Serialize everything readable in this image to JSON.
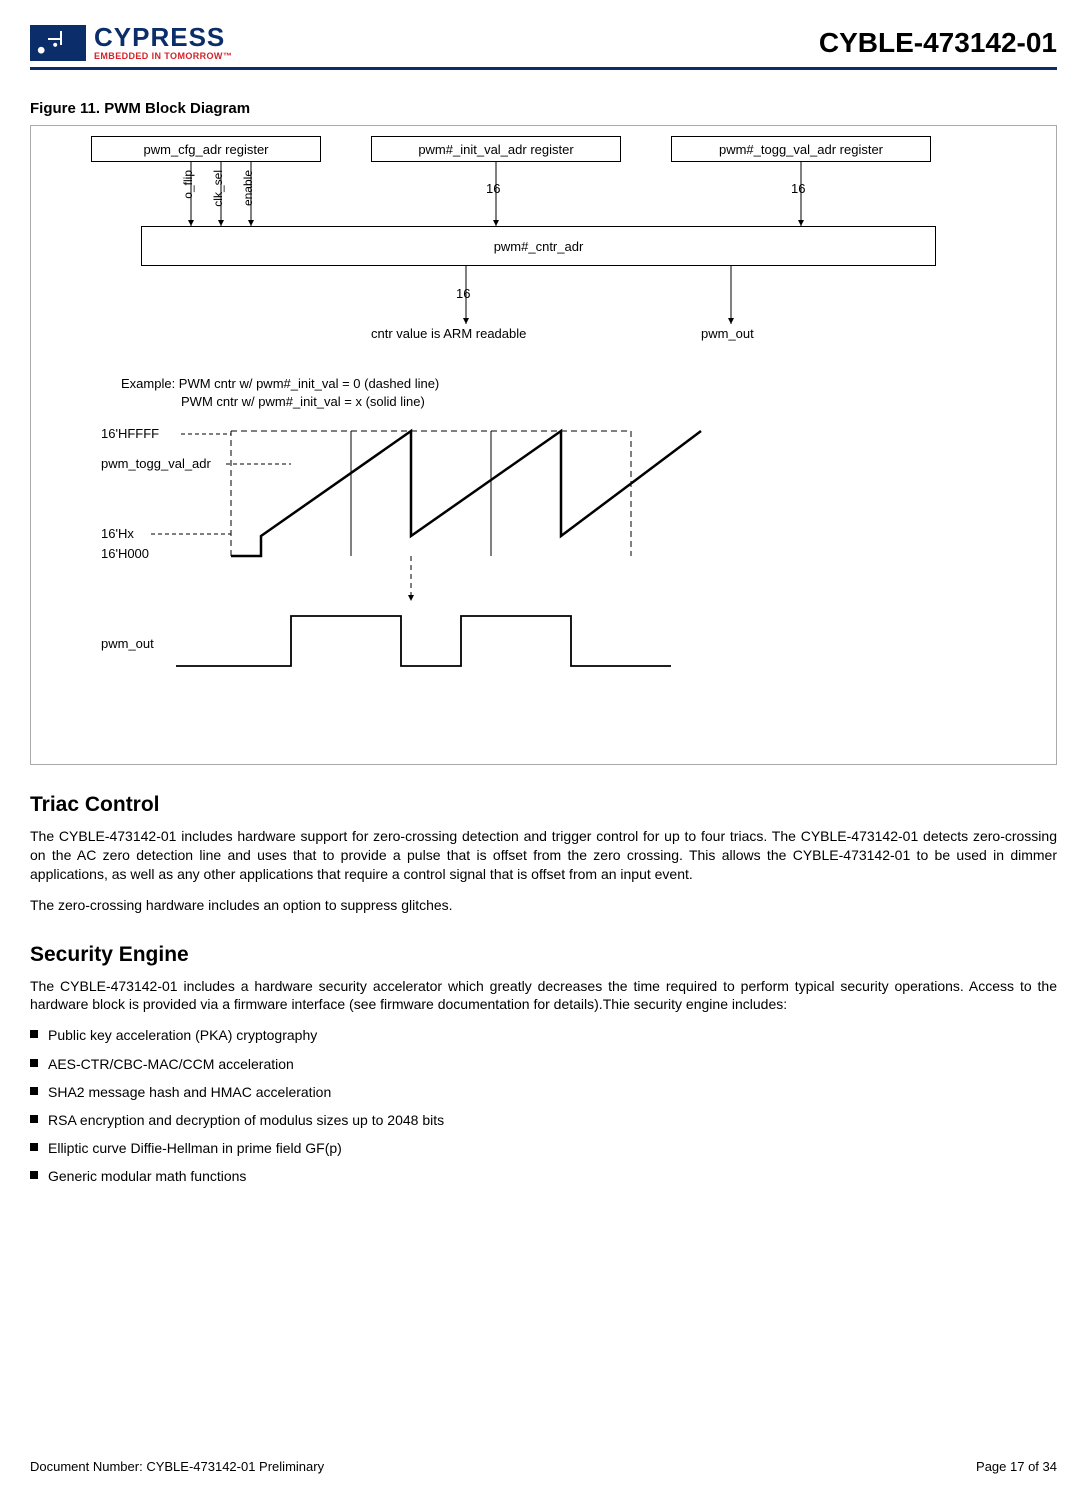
{
  "header": {
    "logo_word": "CYPRESS",
    "logo_sub": "EMBEDDED IN TOMORROW™",
    "part_number": "CYBLE-473142-01"
  },
  "figure": {
    "caption": "Figure 11.  PWM Block Diagram",
    "reg_cfg": "pwm_cfg_adr register",
    "reg_init": "pwm#_init_val_adr register",
    "reg_togg": "pwm#_togg_val_adr register",
    "sig_oflip": "o_flip",
    "sig_clksel": "clk_sel",
    "sig_enable": "enable",
    "bus_16a": "16",
    "bus_16b": "16",
    "bus_16c": "16",
    "reg_cntr": "pwm#_cntr_adr",
    "cntr_readable": "cntr value is ARM readable",
    "pwm_out_top": "pwm_out",
    "example_l1": "Example: PWM cntr w/ pwm#_init_val = 0 (dashed line)",
    "example_l2": "PWM cntr w/ pwm#_init_val = x (solid line)",
    "lbl_hffff": "16'HFFFF",
    "lbl_togg": "pwm_togg_val_adr",
    "lbl_hx": "16'Hx",
    "lbl_h000": "16'H000",
    "pwm_out_bottom": "pwm_out"
  },
  "sections": {
    "triac": {
      "heading": "Triac Control",
      "p1": "The CYBLE-473142-01 includes hardware support for zero-crossing detection and trigger control for up to four triacs. The CYBLE-473142-01 detects zero-crossing on the AC zero detection line and uses that to provide a pulse that is offset from the zero crossing. This allows the CYBLE-473142-01 to be used in dimmer applications, as well as any other applications that require a control signal that is offset from an input event.",
      "p2": "The zero-crossing hardware includes an option to suppress glitches."
    },
    "security": {
      "heading": "Security Engine",
      "p1": "The CYBLE-473142-01 includes a hardware security accelerator which greatly decreases the time required to perform typical security operations. Access to the hardware block is provided via a firmware interface (see firmware documentation for details).Thie security engine includes:",
      "bullets": [
        "Public key acceleration (PKA) cryptography",
        "AES-CTR/CBC-MAC/CCM acceleration",
        "SHA2 message hash and HMAC acceleration",
        "RSA encryption and decryption of modulus sizes up to 2048 bits",
        "Elliptic curve Diffie-Hellman in prime field GF(p)",
        "Generic modular math functions"
      ]
    }
  },
  "footer": {
    "doc_num": "Document Number: CYBLE-473142-01 Preliminary",
    "page": "Page 17 of 34"
  }
}
